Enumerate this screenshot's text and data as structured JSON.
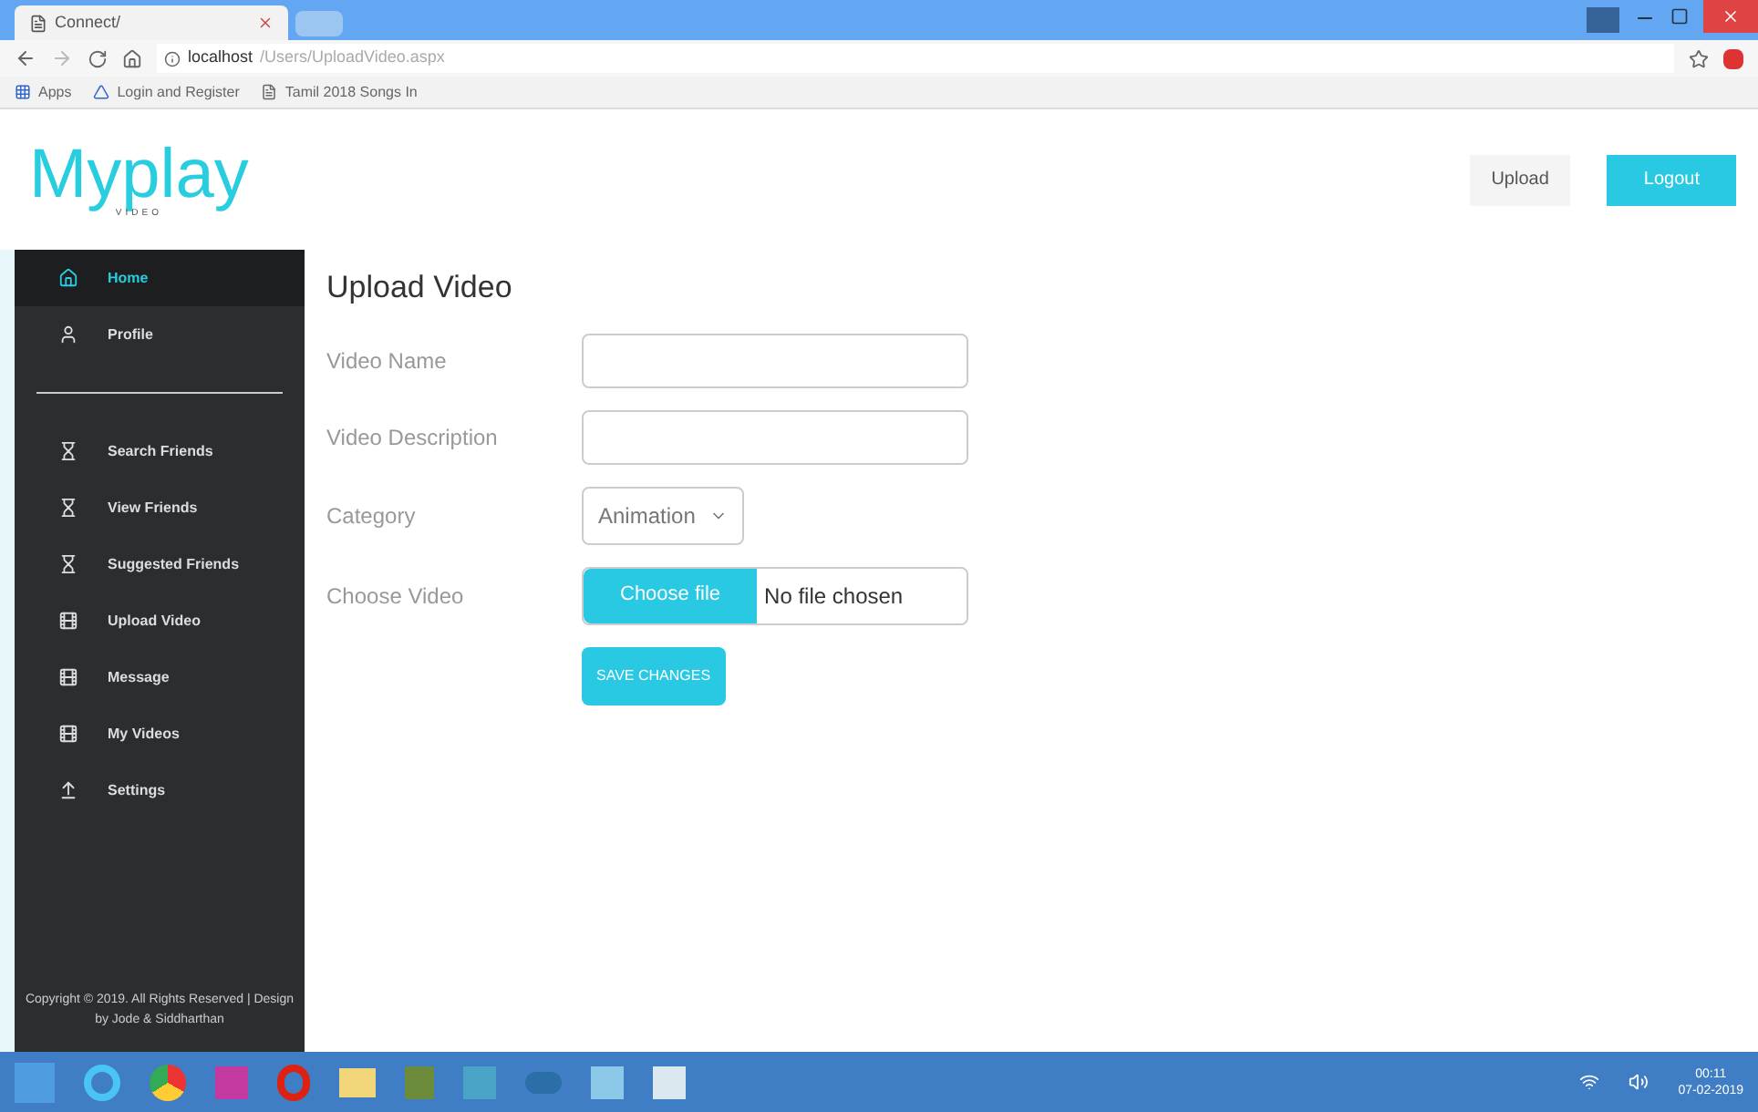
{
  "browser": {
    "tab_title": "Connect/",
    "url_host": "localhost",
    "url_path": "/Users/UploadVideo.aspx",
    "bookmarks": [
      "Apps",
      "Login and Register",
      "Tamil 2018 Songs In"
    ]
  },
  "header": {
    "logo": "Myplay",
    "logo_sub": "VIDEO",
    "buttons": [
      {
        "label": "Upload",
        "kind": "plain"
      },
      {
        "label": "Logout",
        "kind": "primary"
      }
    ]
  },
  "sidebar": {
    "groups": [
      [
        {
          "label": "Home",
          "selected": true
        },
        {
          "label": "Profile",
          "selected": false
        }
      ],
      [
        {
          "label": "Search Friends",
          "selected": false
        },
        {
          "label": "View Friends",
          "selected": false
        },
        {
          "label": "Suggested Friends",
          "selected": false
        },
        {
          "label": "Upload Video",
          "selected": false
        },
        {
          "label": "Message",
          "selected": false
        },
        {
          "label": "My Videos",
          "selected": false
        },
        {
          "label": "Settings",
          "selected": false
        }
      ]
    ],
    "footer": "Copyright © 2019. All Rights Reserved | Design by Jode & Siddharthan"
  },
  "form": {
    "title": "Upload Video",
    "fields": [
      {
        "label": "Video Name",
        "kind": "text"
      },
      {
        "label": "Video Description",
        "kind": "text"
      },
      {
        "label": "Category",
        "kind": "select",
        "value": "Animation"
      },
      {
        "label": "Choose Video",
        "kind": "file",
        "button": "Choose file",
        "value": "No file chosen"
      }
    ],
    "submit": "SAVE CHANGES"
  },
  "taskbar": {
    "time": "00:11",
    "date": "07-02-2019"
  }
}
